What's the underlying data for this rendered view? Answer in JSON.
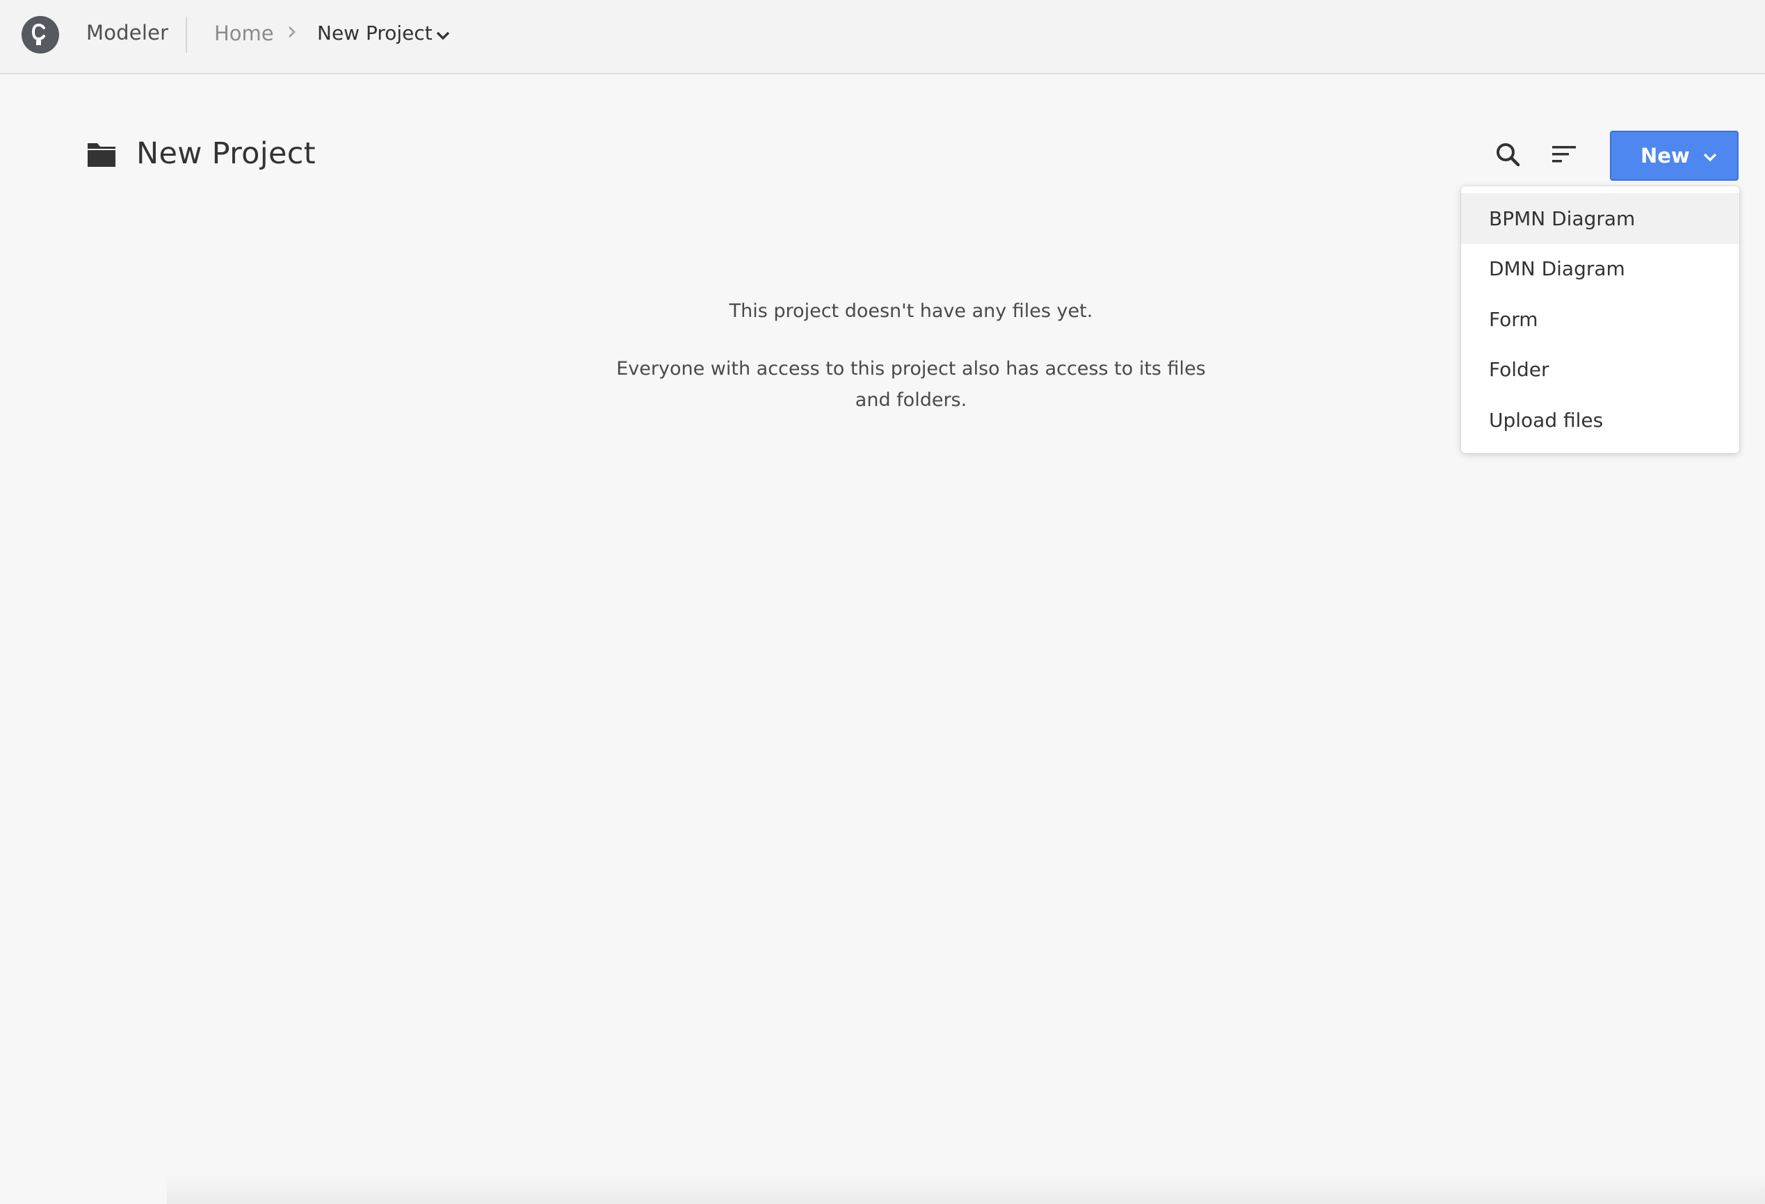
{
  "app": {
    "name": "Modeler"
  },
  "breadcrumb": {
    "home": "Home",
    "current": "New Project"
  },
  "header": {
    "title": "New Project",
    "new_button_label": "New"
  },
  "menu": {
    "items": [
      {
        "label": "BPMN Diagram"
      },
      {
        "label": "DMN Diagram"
      },
      {
        "label": "Form"
      },
      {
        "label": "Folder"
      },
      {
        "label": "Upload files"
      }
    ]
  },
  "empty_state": {
    "primary": "This project doesn't have any files yet.",
    "secondary": "Everyone with access to this project also has access to its files and folders."
  },
  "icons": {
    "logo": "camunda-logo-icon",
    "breadcrumb_separator": "chevron-right-icon",
    "breadcrumb_dropdown": "chevron-down-icon",
    "folder": "folder-icon",
    "search": "search-icon",
    "sort": "sort-icon",
    "new_dropdown": "chevron-down-icon"
  },
  "colors": {
    "accent": "#4d87ef",
    "background": "#f7f7f7",
    "topbar": "#f3f3f4",
    "text": "#333333"
  }
}
